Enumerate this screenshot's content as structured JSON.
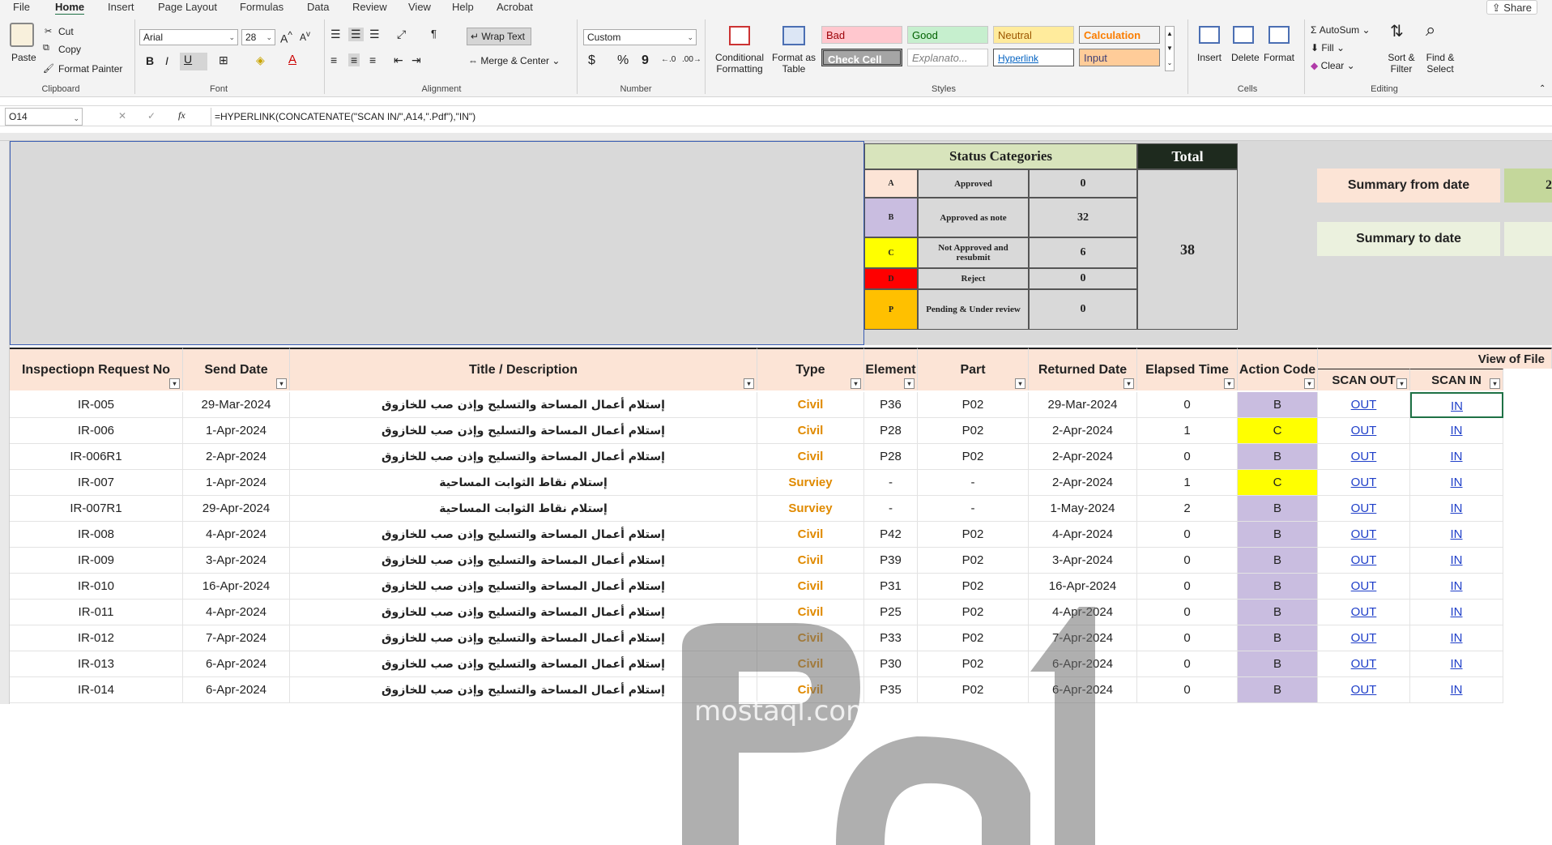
{
  "menu": {
    "items": [
      "File",
      "Home",
      "Insert",
      "Page Layout",
      "Formulas",
      "Data",
      "Review",
      "View",
      "Help",
      "Acrobat"
    ],
    "share": "Share"
  },
  "ribbon": {
    "clipboard": {
      "paste": "Paste",
      "cut": "Cut",
      "copy": "Copy",
      "format_painter": "Format Painter",
      "label": "Clipboard"
    },
    "font": {
      "name": "Arial",
      "size": "28",
      "label": "Font",
      "bold": "B",
      "italic": "I",
      "underline": "U"
    },
    "alignment": {
      "wrap_text": "Wrap Text",
      "merge_center": "Merge & Center",
      "label": "Alignment"
    },
    "number": {
      "format": "Custom",
      "label": "Number",
      "currency": "$",
      "percent": "%",
      "comma": "9"
    },
    "styles": {
      "conditional": "Conditional Formatting",
      "format_table": "Format as Table",
      "cells": [
        "Bad",
        "Good",
        "Neutral",
        "Calculation",
        "Check Cell",
        "Explanato...",
        "Hyperlink",
        "Input"
      ],
      "label": "Styles"
    },
    "cells": {
      "insert": "Insert",
      "delete": "Delete",
      "format": "Format",
      "label": "Cells"
    },
    "editing": {
      "autosum": "AutoSum",
      "fill": "Fill",
      "clear": "Clear",
      "sort_filter": "Sort & Filter",
      "find_select": "Find & Select",
      "label": "Editing"
    }
  },
  "formula_bar": {
    "name_box": "O14",
    "formula": "=HYPERLINK(CONCATENATE(\"SCAN IN/\",A14,\".Pdf\"),\"IN\")"
  },
  "status_summary": {
    "title": "Status  Categories",
    "total_label": "Total",
    "total_value": "38",
    "rows": [
      {
        "code": "A",
        "label": "Approved",
        "count": "0",
        "color": "#fce4d6"
      },
      {
        "code": "B",
        "label": "Approved as note",
        "count": "32",
        "color": "#c9bde0"
      },
      {
        "code": "C",
        "label": "Not Approved and resubmit",
        "count": "6",
        "color": "#ffff00"
      },
      {
        "code": "D",
        "label": "Reject",
        "count": "0",
        "color": "#ff0000"
      },
      {
        "code": "P",
        "label": "Pending & Under review",
        "count": "0",
        "color": "#ffc000"
      }
    ],
    "summary_from": "Summary from date",
    "summary_from_value": "2",
    "summary_to": "Summary to date"
  },
  "table": {
    "view_of_file": "View of File",
    "headers": [
      "Inspectiopn Request No",
      "Send Date",
      "Title / Description",
      "Type",
      "Element",
      "Part",
      "Returned Date",
      "Elapsed Time",
      "Action Code",
      "SCAN OUT",
      "SCAN IN"
    ],
    "rows": [
      {
        "no": "IR-005",
        "send": "29-Mar-2024",
        "title": "إستلام أعمال المساحة والتسليح وإذن صب للخازوق",
        "type": "Civil",
        "element": "P36",
        "part": "P02",
        "returned": "29-Mar-2024",
        "elapsed": "0",
        "code": "B",
        "out": "OUT",
        "in": "IN"
      },
      {
        "no": "IR-006",
        "send": "1-Apr-2024",
        "title": "إستلام أعمال المساحة والتسليح وإذن صب للخازوق",
        "type": "Civil",
        "element": "P28",
        "part": "P02",
        "returned": "2-Apr-2024",
        "elapsed": "1",
        "code": "C",
        "out": "OUT",
        "in": "IN"
      },
      {
        "no": "IR-006R1",
        "send": "2-Apr-2024",
        "title": "إستلام أعمال المساحة والتسليح وإذن صب للخازوق",
        "type": "Civil",
        "element": "P28",
        "part": "P02",
        "returned": "2-Apr-2024",
        "elapsed": "0",
        "code": "B",
        "out": "OUT",
        "in": "IN"
      },
      {
        "no": "IR-007",
        "send": "1-Apr-2024",
        "title": "إستلام نقاط الثوابت المساحية",
        "type": "Surviey",
        "element": "-",
        "part": "-",
        "returned": "2-Apr-2024",
        "elapsed": "1",
        "code": "C",
        "out": "OUT",
        "in": "IN"
      },
      {
        "no": "IR-007R1",
        "send": "29-Apr-2024",
        "title": "إستلام نقاط الثوابت المساحية",
        "type": "Surviey",
        "element": "-",
        "part": "-",
        "returned": "1-May-2024",
        "elapsed": "2",
        "code": "B",
        "out": "OUT",
        "in": "IN"
      },
      {
        "no": "IR-008",
        "send": "4-Apr-2024",
        "title": "إستلام أعمال المساحة والتسليح وإذن صب للخازوق",
        "type": "Civil",
        "element": "P42",
        "part": "P02",
        "returned": "4-Apr-2024",
        "elapsed": "0",
        "code": "B",
        "out": "OUT",
        "in": "IN"
      },
      {
        "no": "IR-009",
        "send": "3-Apr-2024",
        "title": "إستلام أعمال المساحة والتسليح وإذن صب للخازوق",
        "type": "Civil",
        "element": "P39",
        "part": "P02",
        "returned": "3-Apr-2024",
        "elapsed": "0",
        "code": "B",
        "out": "OUT",
        "in": "IN"
      },
      {
        "no": "IR-010",
        "send": "16-Apr-2024",
        "title": "إستلام أعمال المساحة والتسليح وإذن صب للخازوق",
        "type": "Civil",
        "element": "P31",
        "part": "P02",
        "returned": "16-Apr-2024",
        "elapsed": "0",
        "code": "B",
        "out": "OUT",
        "in": "IN"
      },
      {
        "no": "IR-011",
        "send": "4-Apr-2024",
        "title": "إستلام أعمال المساحة والتسليح وإذن صب للخازوق",
        "type": "Civil",
        "element": "P25",
        "part": "P02",
        "returned": "4-Apr-2024",
        "elapsed": "0",
        "code": "B",
        "out": "OUT",
        "in": "IN"
      },
      {
        "no": "IR-012",
        "send": "7-Apr-2024",
        "title": "إستلام أعمال المساحة والتسليح وإذن صب للخازوق",
        "type": "Civil",
        "element": "P33",
        "part": "P02",
        "returned": "7-Apr-2024",
        "elapsed": "0",
        "code": "B",
        "out": "OUT",
        "in": "IN"
      },
      {
        "no": "IR-013",
        "send": "6-Apr-2024",
        "title": "إستلام أعمال المساحة والتسليح وإذن صب للخازوق",
        "type": "Civil",
        "element": "P30",
        "part": "P02",
        "returned": "6-Apr-2024",
        "elapsed": "0",
        "code": "B",
        "out": "OUT",
        "in": "IN"
      },
      {
        "no": "IR-014",
        "send": "6-Apr-2024",
        "title": "إستلام أعمال المساحة والتسليح وإذن صب للخازوق",
        "type": "Civil",
        "element": "P35",
        "part": "P02",
        "returned": "6-Apr-2024",
        "elapsed": "0",
        "code": "B",
        "out": "OUT",
        "in": "IN"
      }
    ],
    "code_colors": {
      "B": "#c9bde0",
      "C": "#ffff00"
    }
  },
  "watermark": {
    "text": "mostaql.com"
  }
}
